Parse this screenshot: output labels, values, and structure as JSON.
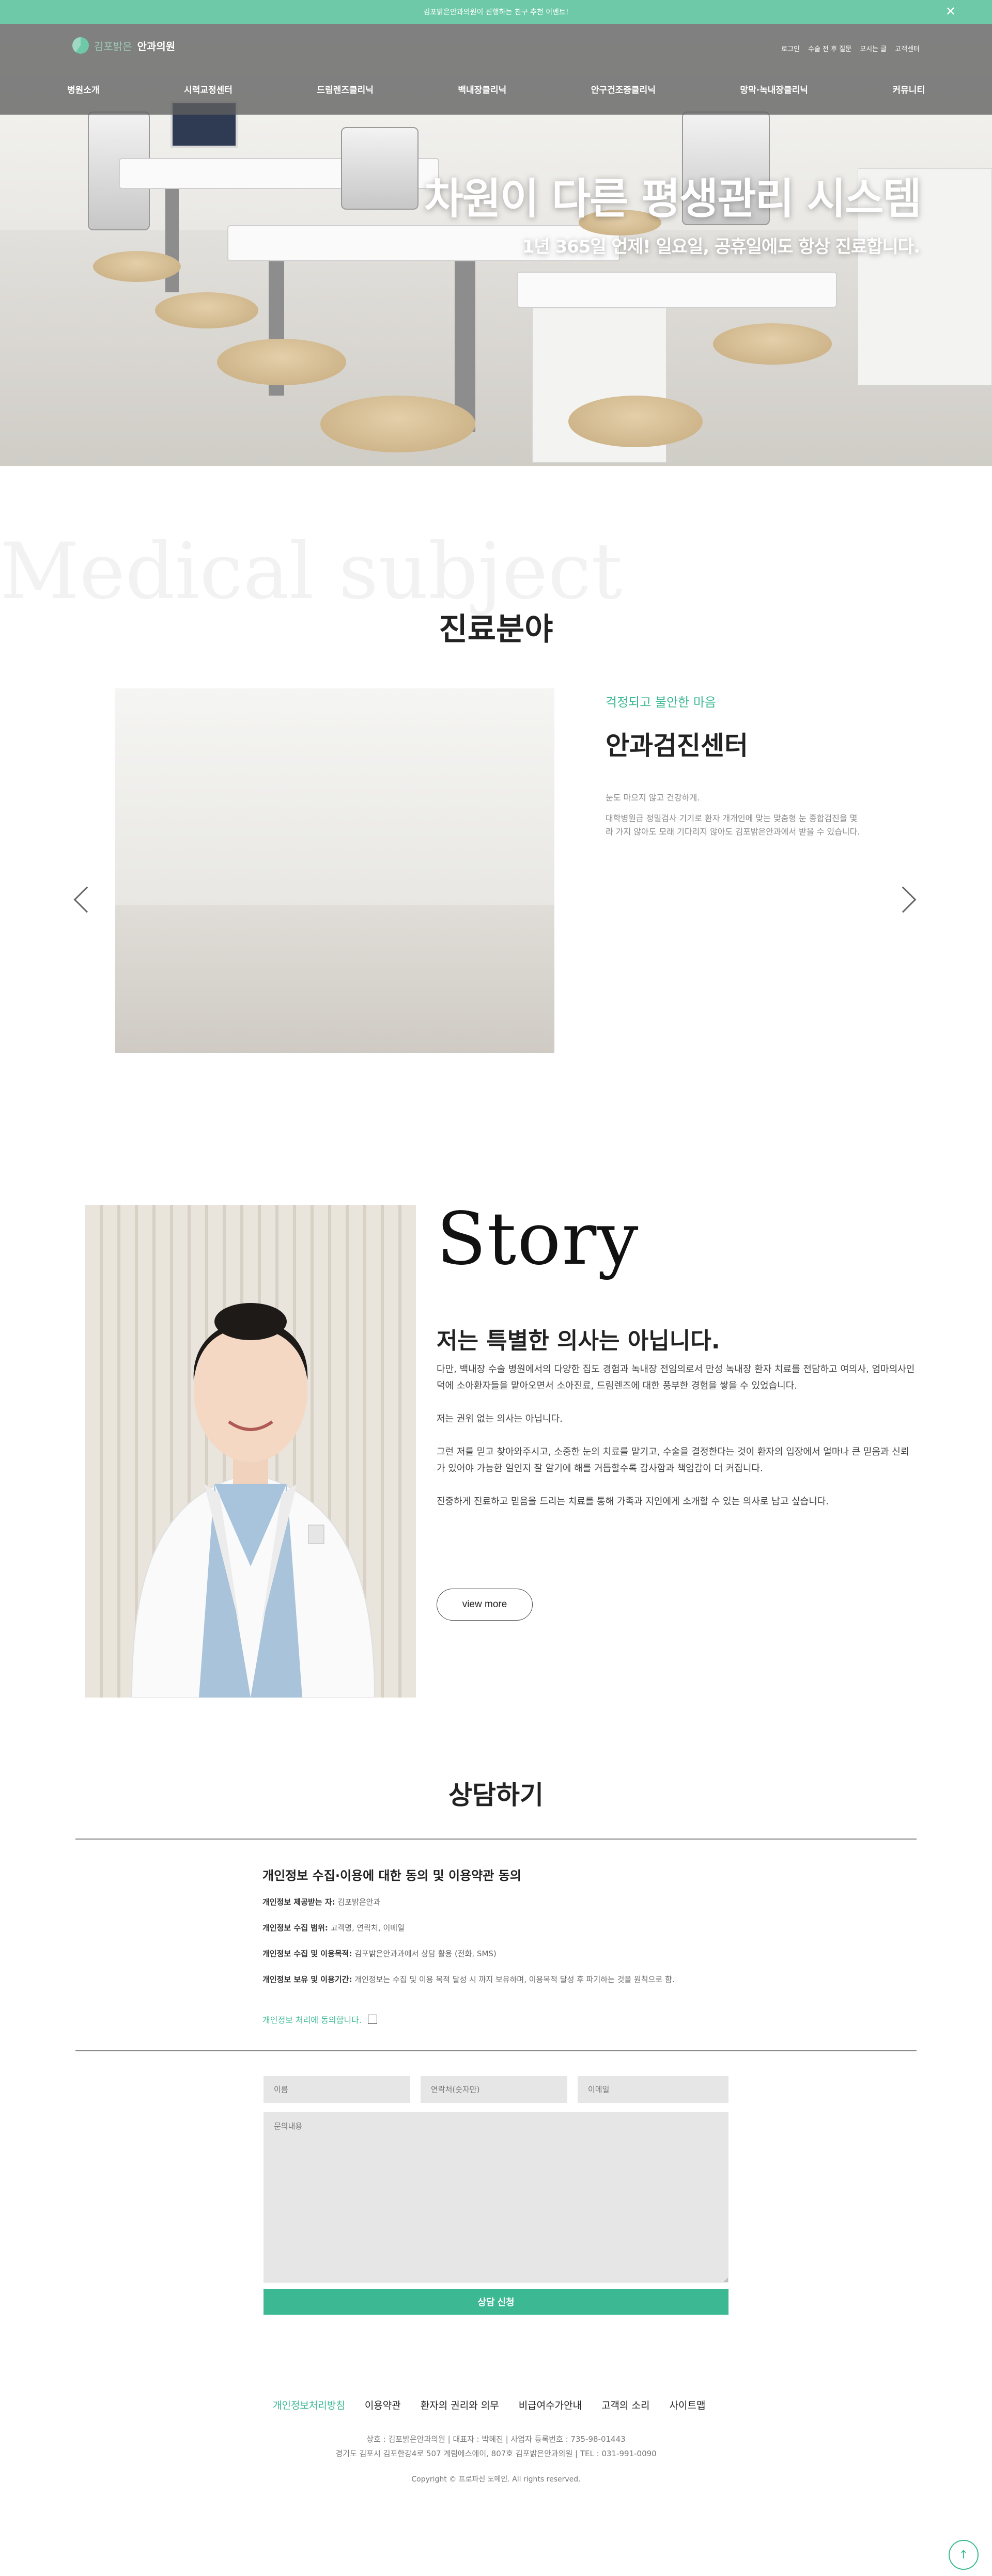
{
  "top_banner": {
    "text": "김포밝은안과의원이 진행하는 친구 추천 이벤트!",
    "close": "✕"
  },
  "logo": {
    "part1": "김포밝은",
    "part2": "안과의원"
  },
  "util_links": [
    "로그인",
    "수술 전 후 질문",
    "모시는 글",
    "고객센터"
  ],
  "nav": [
    "병원소개",
    "시력교정센터",
    "드림렌즈클리닉",
    "백내장클리닉",
    "안구건조증클리닉",
    "망막·녹내장클리닉",
    "커뮤니티"
  ],
  "hero": {
    "title": "차원이 다른 평생관리 시스템",
    "subtitle": "1년 365일 언제! 일요일, 공휴일에도 항상 진료합니다."
  },
  "medical": {
    "bg_word": "Medical subject",
    "title": "진료분야",
    "tag": "걱정되고 불안한 마음",
    "heading": "안과검진센터",
    "p1": "눈도 마으지 않고 건강하게.",
    "p2": "대학병원급 정밀검사 기기로 환자 개개인에 맞는 맞춤형 눈 종합검진을 몇라 가지 않아도 모래 기다리지 않아도 김포밝은안과에서 받을 수 있습니다."
  },
  "story": {
    "word": "Story",
    "heading": "저는 특별한 의사는 아닙니다.",
    "p1": "다만, 백내장 수술 병원에서의 다양한 집도 경험과 녹내장 전임의로서 만성 녹내장 환자 치료를 전담하고 여의사, 엄마의사인 덕에 소아환자들을 맡아오면서 소아진료, 드림렌즈에 대한 풍부한 경험을 쌓을 수 있었습니다.",
    "p2": "저는 권위 없는 의사는 아닙니다.",
    "p3": "그런 저를 믿고 찾아와주시고, 소중한 눈의 치료를 맡기고, 수술을 결정한다는 것이 환자의 입장에서 얼마나 큰 믿음과 신뢰가 있어야 가능한 일인지 잘 알기에 해를 거듭할수록 감사함과 책임감이 더 커집니다.",
    "p4": "진중하게 진료하고 믿음을 드리는 치료를 통해 가족과 지인에게 소개할 수 있는 의사로 남고 싶습니다.",
    "button": "view more"
  },
  "consult": {
    "title": "상담하기",
    "agree_title": "개인정보 수집·이용에 대한 동의 및 이용약관 동의",
    "items": [
      {
        "label": "개인정보 제공받는 자:",
        "value": "김포밝은안과"
      },
      {
        "label": "개인정보 수집 범위:",
        "value": "고객명, 연락처, 이메일"
      },
      {
        "label": "개인정보 수집 및 이용목적:",
        "value": "김포밝은안과과에서 상담 활용 (전화, SMS)"
      },
      {
        "label": "개인정보 보유 및 이용기간:",
        "value": "개인정보는 수집 및 이용 목적 달성 시 까지 보유하며, 이용목적 달성 후 파기하는 것을 원칙으로 함."
      }
    ],
    "agree_label": "개인정보 처리에 동의합니다.",
    "name_ph": "이름",
    "phone_ph": "연락처(숫자만)",
    "email_ph": "이메일",
    "message_ph": "문의내용",
    "submit": "상담 신청"
  },
  "footer": {
    "links": [
      "개인정보처리방침",
      "이용약관",
      "환자의 권리와 의무",
      "비급여수가안내",
      "고객의 소리",
      "사이트맵"
    ],
    "line1": "상호 : 김포밝은안과의원 | 대표자 : 박혜진 | 사업자 등록번호 : 735-98-01443",
    "line2": "경기도 김포시 김포한강4로 507 계림에스에이, 807호 김포밝은안과의원 | TEL : 031-991-0090",
    "copyright": "Copyright © 프로파선 도메인. All rights reserved."
  },
  "to_top": "↑"
}
